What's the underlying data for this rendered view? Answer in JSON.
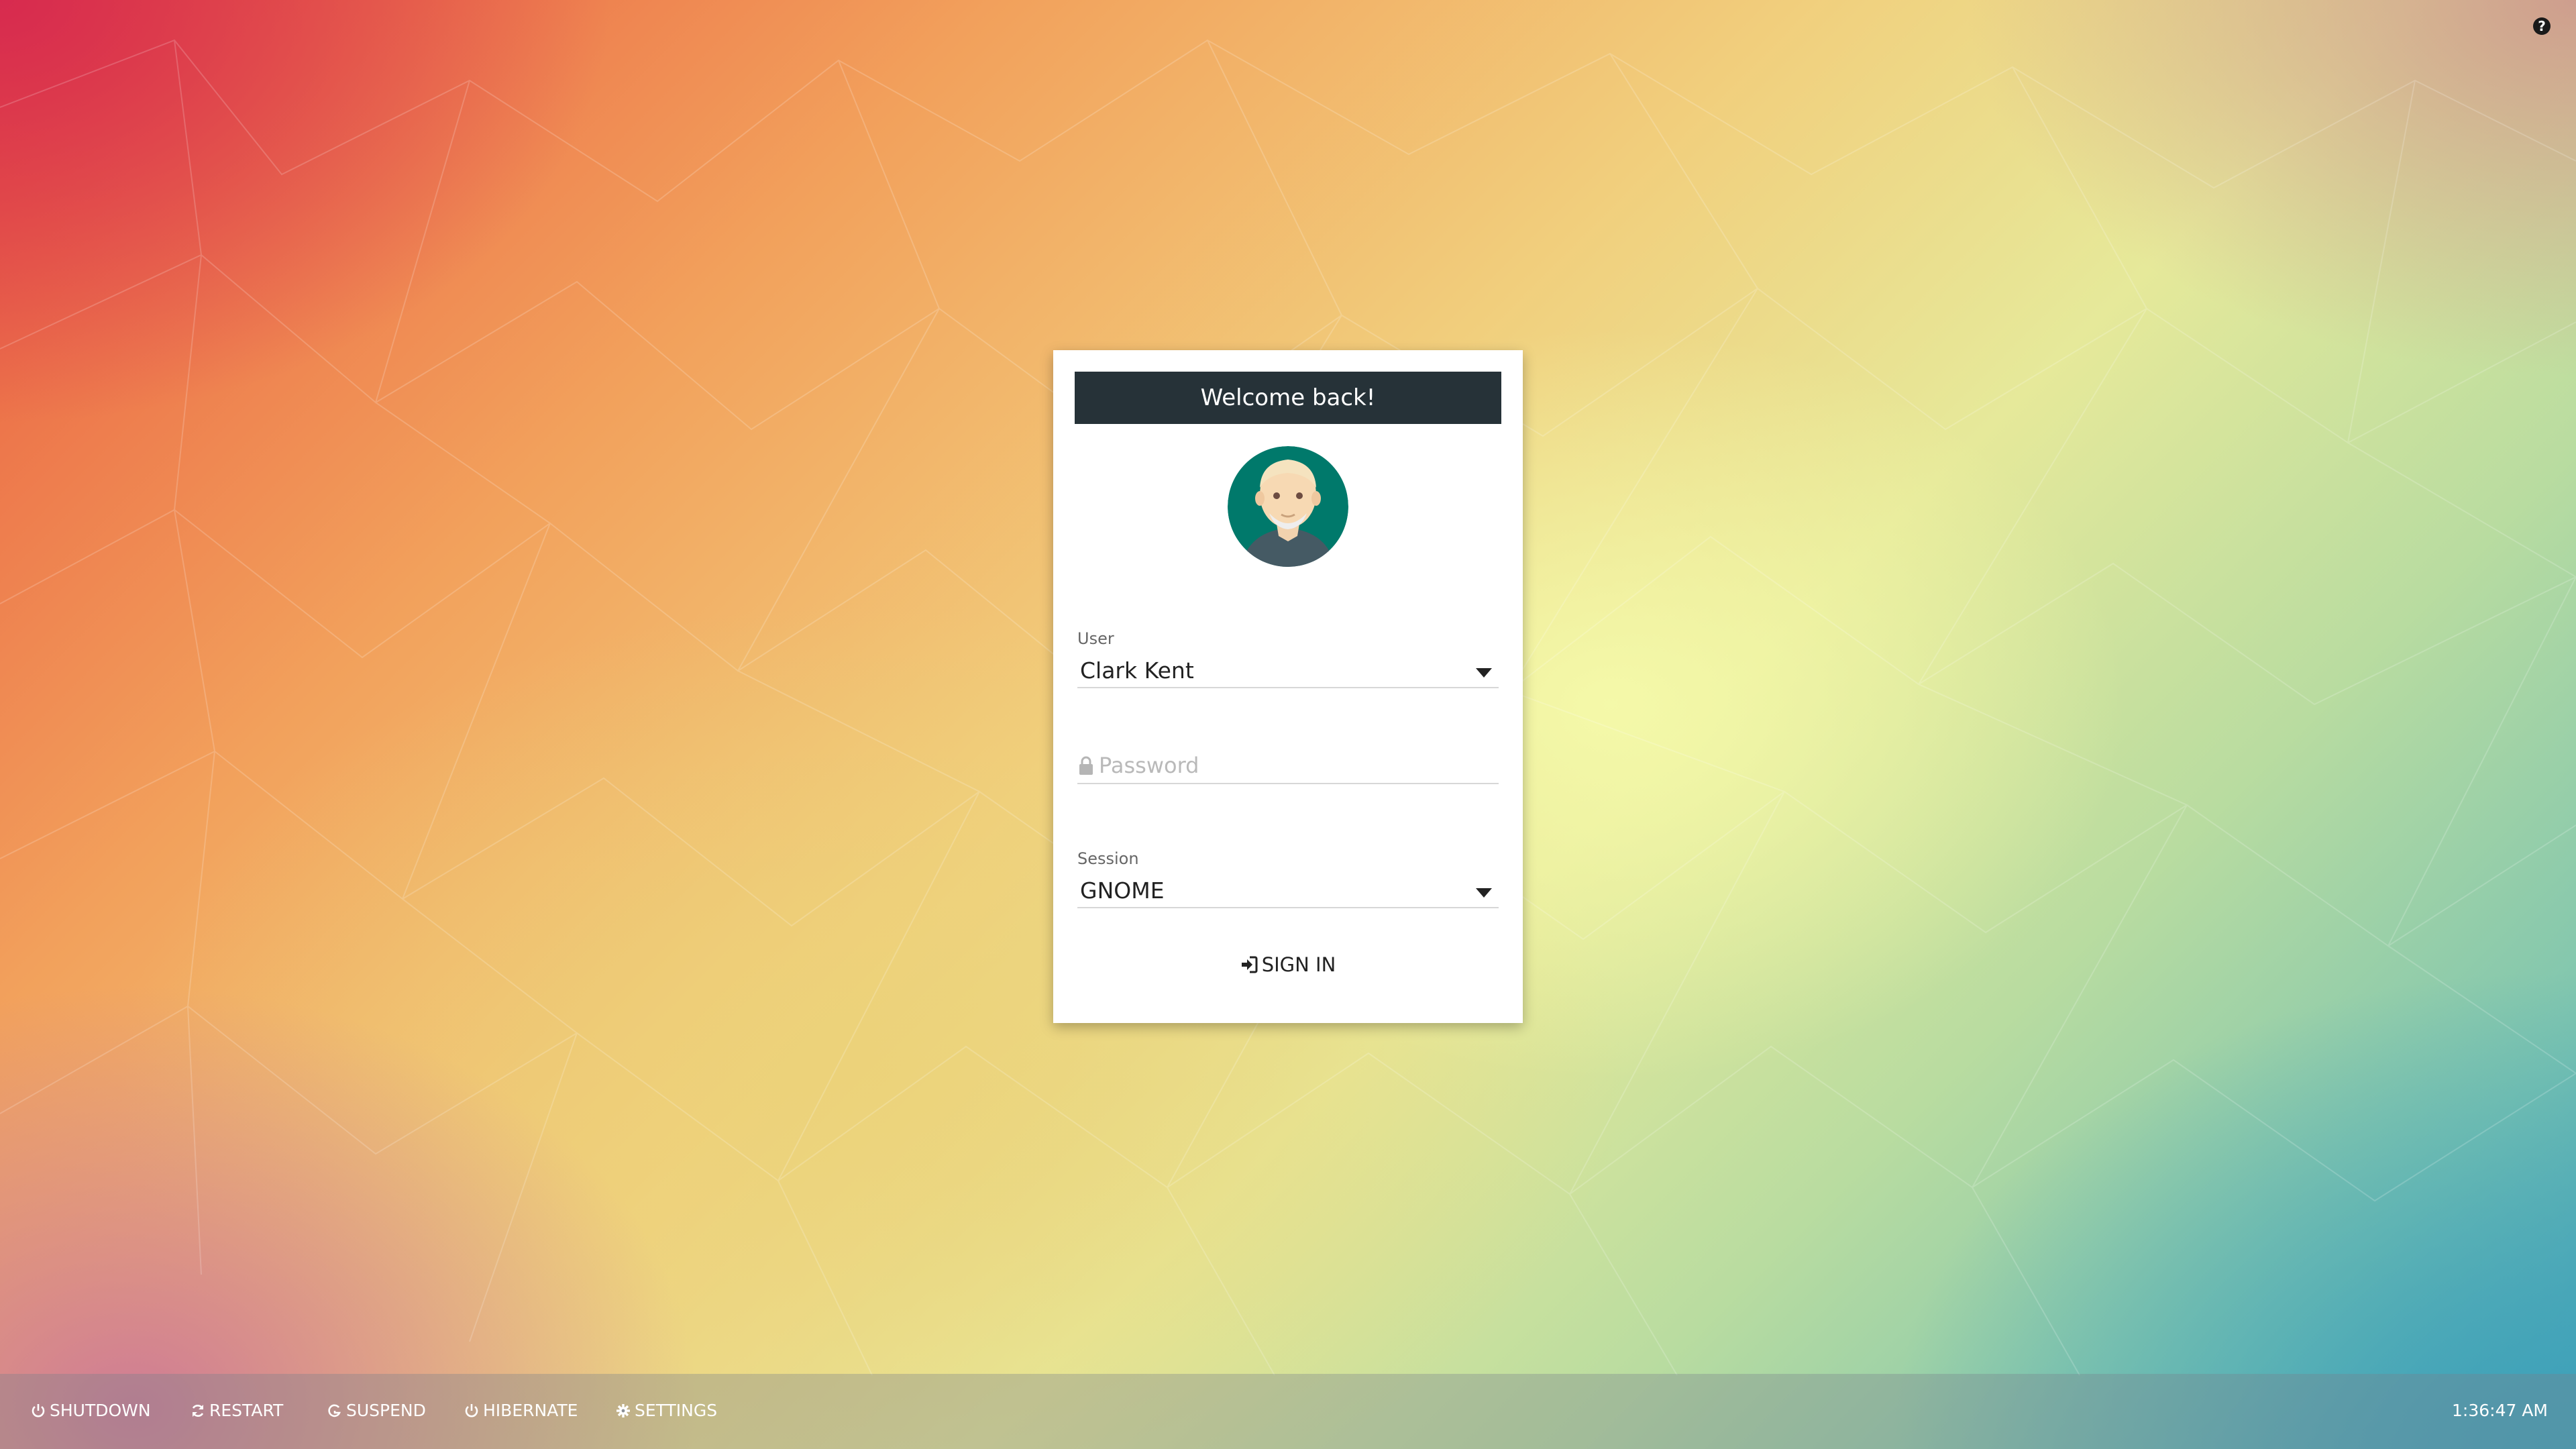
{
  "help": {
    "icon": "help-circle-icon",
    "glyph": "?"
  },
  "login": {
    "header": "Welcome back!",
    "avatar_icon": "user-avatar-icon",
    "user_label": "User",
    "user_value": "Clark Kent",
    "password_placeholder": "Password",
    "session_label": "Session",
    "session_value": "GNOME",
    "signin_label": "SIGN IN"
  },
  "taskbar": {
    "shutdown_label": "SHUTDOWN",
    "restart_label": "RESTART",
    "suspend_label": "SUSPEND",
    "hibernate_label": "HIBERNATE",
    "settings_label": "SETTINGS",
    "clock": "1:36:47 AM"
  },
  "colors": {
    "header_bg": "#263238",
    "card_bg": "#ffffff",
    "avatar_bg": "#00796b",
    "avatar_shirt": "#455a64",
    "text": "#222222",
    "placeholder": "#b9b9b9"
  }
}
